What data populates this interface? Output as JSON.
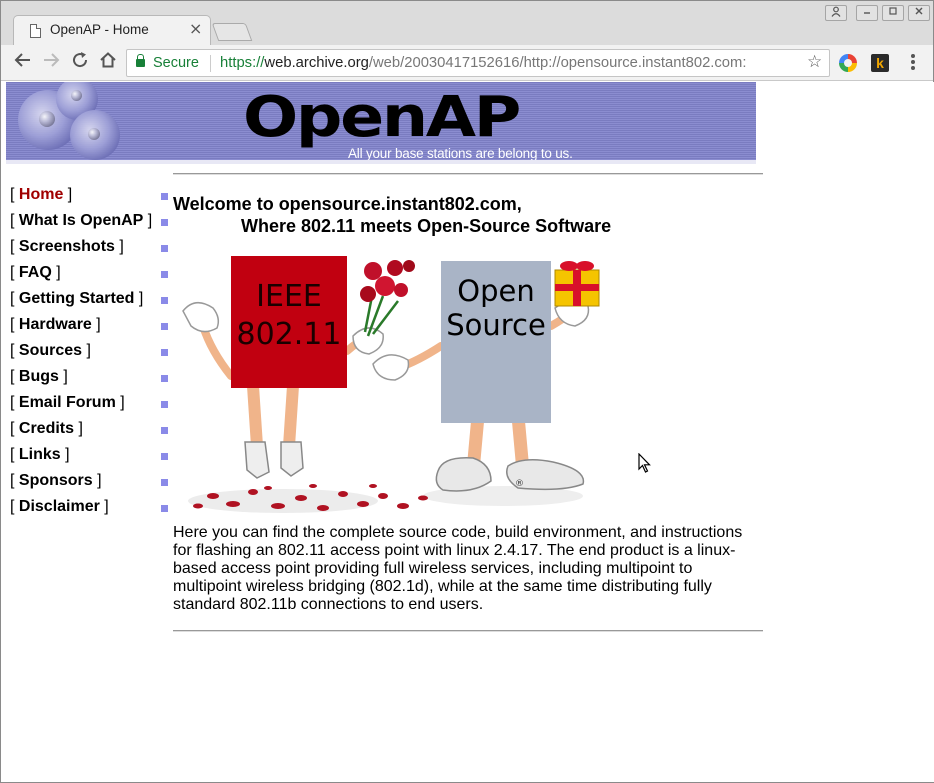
{
  "browser": {
    "tab_title": "OpenAP - Home",
    "tab_close": "×",
    "secure_label": "Secure",
    "url_scheme": "https://",
    "url_host": "web.archive.org",
    "url_path": "/web/20030417152616/http://opensource.instant802.com:",
    "star": "☆",
    "ext_k": "k"
  },
  "banner": {
    "logo": "OpenAP",
    "tagline": "All your base stations are belong to us."
  },
  "nav": {
    "bracket_open": "[ ",
    "bracket_close": " ]",
    "items": [
      {
        "label": "Home"
      },
      {
        "label": "What Is OpenAP"
      },
      {
        "label": "Screenshots"
      },
      {
        "label": "FAQ"
      },
      {
        "label": "Getting Started"
      },
      {
        "label": "Hardware"
      },
      {
        "label": "Sources"
      },
      {
        "label": "Bugs"
      },
      {
        "label": "Email Forum"
      },
      {
        "label": "Credits"
      },
      {
        "label": "Links"
      },
      {
        "label": "Sponsors"
      },
      {
        "label": "Disclaimer"
      }
    ]
  },
  "main": {
    "welcome_line1": "Welcome to opensource.instant802.com,",
    "welcome_line2": "Where 802.11 meets Open-Source Software",
    "sign_left_line1": "IEEE",
    "sign_left_line2": "802.11",
    "sign_right_line1": "Open",
    "sign_right_line2": "Source",
    "registered_mark": "®",
    "intro": "Here you can find the complete source code, build environment, and instructions for flashing an 802.11 access point with linux 2.4.17. The end product is a linux-based access point providing full wireless services, including multipoint to multipoint wireless bridging (802.1d), while at the same time distributing fully standard 802.11b connections to end users."
  },
  "colors": {
    "sign_left": "#c10010",
    "sign_right": "#a9b4c6",
    "nav_current": "#a00000",
    "nav_bullet": "#8a8ae8",
    "secure_green": "#188038"
  }
}
